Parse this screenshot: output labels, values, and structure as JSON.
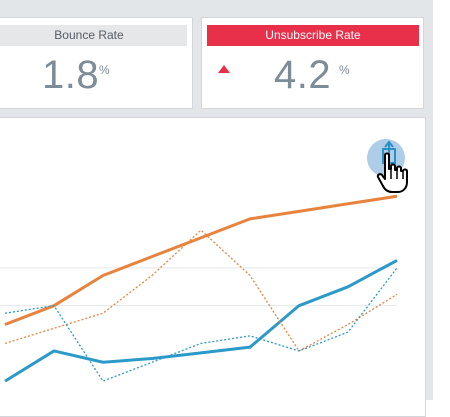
{
  "kpis": {
    "bounce": {
      "label": "Bounce Rate",
      "value": "1.8",
      "unit": "%"
    },
    "unsubscribe": {
      "label": "Unsubscribe Rate",
      "value": "4.2",
      "unit": "%",
      "trend": "up"
    }
  },
  "colors": {
    "alert": "#e8304a",
    "orange": "#e8833d",
    "blue": "#2b9ac9",
    "value_gray": "#7d8c99"
  },
  "icons": {
    "share": "share-icon",
    "cursor": "hand-pointer-icon",
    "trend": "triangle-up-icon"
  },
  "chart_data": {
    "type": "line",
    "x": [
      0,
      1,
      2,
      3,
      4,
      5,
      6,
      7,
      8
    ],
    "series": [
      {
        "values": [
          1.0,
          2.0,
          3.6,
          4.6,
          5.6,
          6.6,
          7.0,
          7.4,
          7.8
        ],
        "style": "solid",
        "color": "#e8833d"
      },
      {
        "values": [
          -2.0,
          -0.4,
          -1.0,
          -0.8,
          -0.5,
          -0.2,
          2.0,
          3.0,
          4.4
        ],
        "style": "solid",
        "color": "#2b9ac9"
      },
      {
        "values": [
          0.0,
          0.8,
          1.6,
          3.6,
          6.0,
          3.6,
          -0.4,
          1.0,
          2.6
        ],
        "style": "dotted",
        "color": "#e8833d"
      },
      {
        "values": [
          1.6,
          2.0,
          -2.0,
          -1.0,
          0.0,
          0.4,
          -0.4,
          0.6,
          4.0
        ],
        "style": "dotted",
        "color": "#2b9ac9"
      }
    ],
    "gridlines_y": [
      2,
      4
    ],
    "ylim": [
      -3,
      12
    ]
  }
}
